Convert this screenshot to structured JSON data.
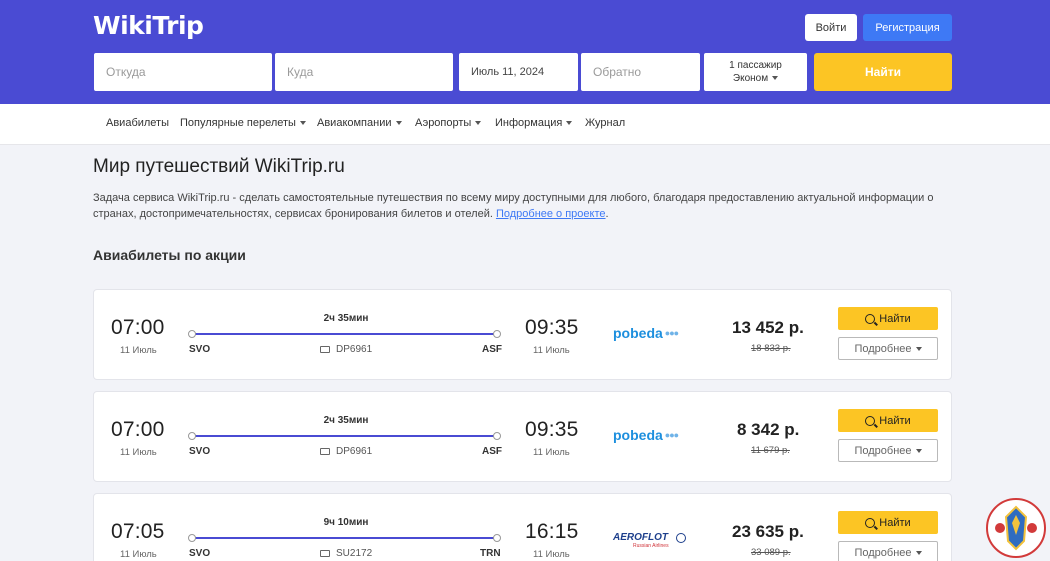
{
  "header": {
    "logo": "WikiTrip",
    "login_label": "Войти",
    "register_label": "Регистрация"
  },
  "search": {
    "from_placeholder": "Откуда",
    "to_placeholder": "Куда",
    "date_value": "Июль 11, 2024",
    "return_placeholder": "Обратно",
    "passengers": "1 пассажир",
    "cabin_class": "Эконом",
    "find_label": "Найти"
  },
  "nav": {
    "items": [
      {
        "label": "Авиабилеты",
        "dropdown": false
      },
      {
        "label": "Популярные перелеты",
        "dropdown": true
      },
      {
        "label": "Авиакомпании",
        "dropdown": true
      },
      {
        "label": "Аэропорты",
        "dropdown": true
      },
      {
        "label": "Информация",
        "dropdown": true
      },
      {
        "label": "Журнал",
        "dropdown": false
      }
    ]
  },
  "intro": {
    "title": "Мир путешествий WikiTrip.ru",
    "text": "Задача сервиса WikiTrip.ru - сделать самостоятельные путешествия по всему миру доступными для любого, благодаря предоставлению актуальной информации о странах, достопримечательностях, сервисах бронирования билетов и отелей.",
    "link_label": "Подробнее о проекте",
    "trailing": "."
  },
  "offers": {
    "title": "Авиабилеты по акции",
    "find_label": "Найти",
    "more_label": "Подробнее",
    "items": [
      {
        "depart_time": "07:00",
        "depart_date": "11 Июль",
        "arrive_time": "09:35",
        "arrive_date": "11 Июль",
        "duration": "2ч 35мин",
        "from": "SVO",
        "to": "ASF",
        "flight": "DP6961",
        "airline": "pobeda",
        "price": "13 452 р.",
        "old_price": "18 833 р."
      },
      {
        "depart_time": "07:00",
        "depart_date": "11 Июль",
        "arrive_time": "09:35",
        "arrive_date": "11 Июль",
        "duration": "2ч 35мин",
        "from": "SVO",
        "to": "ASF",
        "flight": "DP6961",
        "airline": "pobeda",
        "price": "8 342 р.",
        "old_price": "11 679 р."
      },
      {
        "depart_time": "07:05",
        "depart_date": "11 Июль",
        "arrive_time": "16:15",
        "arrive_date": "11 Июль",
        "duration": "9ч 10мин",
        "from": "SVO",
        "to": "TRN",
        "flight": "SU2172",
        "airline": "AEROFLOT",
        "airline_sub": "Russian Airlines",
        "price": "23 635 р.",
        "old_price": "33 089 р."
      }
    ]
  },
  "colors": {
    "header_bg": "#4a4bd3",
    "accent_yellow": "#fcc524",
    "register_blue": "#3e79f5",
    "page_bg": "#f2f3f8"
  }
}
